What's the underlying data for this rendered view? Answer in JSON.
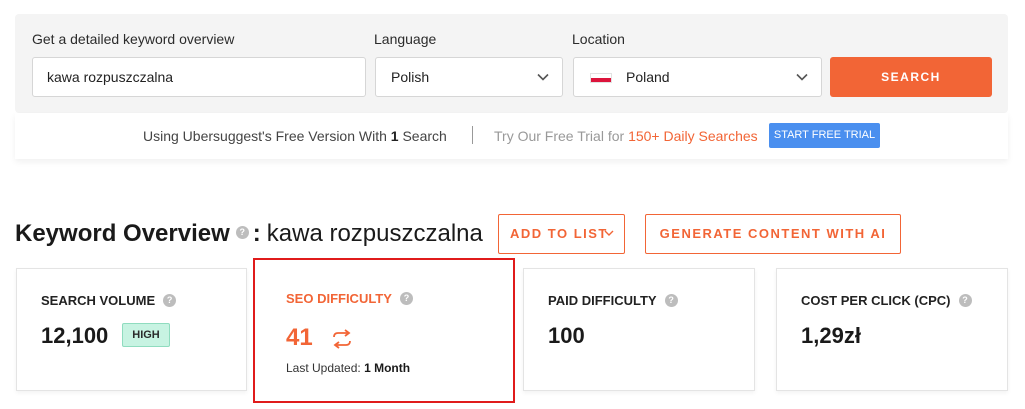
{
  "search_form": {
    "keyword_label": "Get a detailed keyword overview",
    "keyword_value": "kawa rozpuszczalna",
    "language_label": "Language",
    "language_value": "Polish",
    "location_label": "Location",
    "location_value": "Poland",
    "search_button": "SEARCH"
  },
  "trial_bar": {
    "free_text_prefix": "Using Ubersuggest's Free Version With",
    "free_count": "1",
    "free_text_suffix": "Search",
    "separator": "|",
    "try_text": "Try Our Free Trial for",
    "try_highlight": "150+ Daily Searches",
    "start_button": "START FREE TRIAL"
  },
  "overview": {
    "title": "Keyword Overview",
    "help_icon": "?",
    "colon": ":",
    "keyword": "kawa rozpuszczalna",
    "add_to_list": "ADD TO LIST",
    "generate_button": "GENERATE CONTENT WITH AI"
  },
  "metrics": {
    "search_volume": {
      "label": "SEARCH VOLUME",
      "value": "12,100",
      "badge": "HIGH"
    },
    "seo_difficulty": {
      "label": "SEO DIFFICULTY",
      "value": "41",
      "updated_label": "Last Updated:",
      "updated_value": "1 Month"
    },
    "paid_difficulty": {
      "label": "PAID DIFFICULTY",
      "value": "100"
    },
    "cpc": {
      "label": "COST PER CLICK (CPC)",
      "value": "1,29zł"
    }
  },
  "colors": {
    "accent": "#f26536",
    "trial_button": "#4a8fef",
    "highlight_border": "#e01b1b",
    "badge_bg": "#c7f3e2"
  },
  "icons": [
    "chevron-down-icon",
    "poland-flag-icon",
    "help-icon",
    "refresh-icon"
  ]
}
